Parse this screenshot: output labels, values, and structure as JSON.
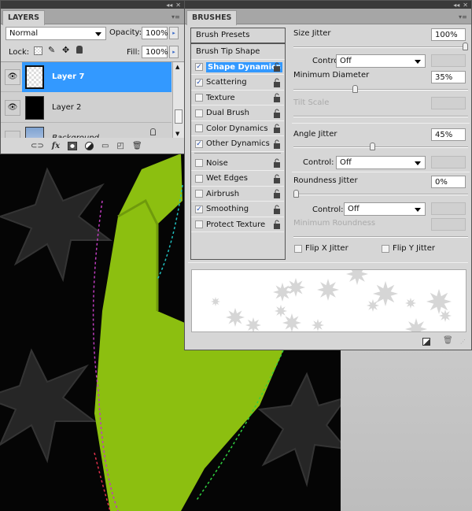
{
  "layers_panel": {
    "tab": "LAYERS",
    "blend_mode": "Normal",
    "opacity_label": "Opacity:",
    "opacity_value": "100%",
    "lock_label": "Lock:",
    "fill_label": "Fill:",
    "fill_value": "100%",
    "layers": [
      {
        "name": "Layer 7",
        "visible": true,
        "selected": true
      },
      {
        "name": "Layer 2",
        "visible": true,
        "selected": false
      },
      {
        "name": "Background",
        "visible": false,
        "selected": false,
        "locked": true
      }
    ],
    "footer_icons": [
      "link-icon",
      "fx-icon",
      "mask-icon",
      "adjustment-icon",
      "folder-icon",
      "new-layer-icon",
      "trash-icon"
    ]
  },
  "brushes_panel": {
    "tab": "BRUSHES",
    "presets_button": "Brush Presets",
    "tip_shape": "Brush Tip Shape",
    "options": [
      {
        "label": "Shape Dynamics",
        "checked": true,
        "selected": true
      },
      {
        "label": "Scattering",
        "checked": true
      },
      {
        "label": "Texture",
        "checked": false
      },
      {
        "label": "Dual Brush",
        "checked": false
      },
      {
        "label": "Color Dynamics",
        "checked": false
      },
      {
        "label": "Other Dynamics",
        "checked": true
      },
      {
        "label": "Noise",
        "checked": false
      },
      {
        "label": "Wet Edges",
        "checked": false
      },
      {
        "label": "Airbrush",
        "checked": false
      },
      {
        "label": "Smoothing",
        "checked": true
      },
      {
        "label": "Protect Texture",
        "checked": false
      }
    ],
    "size_jitter": {
      "label": "Size Jitter",
      "value": "100%",
      "slider": 1.0
    },
    "control_label": "Control:",
    "control1": "Off",
    "min_diameter": {
      "label": "Minimum Diameter",
      "value": "35%",
      "slider": 0.35
    },
    "tilt_scale": {
      "label": "Tilt Scale"
    },
    "angle_jitter": {
      "label": "Angle Jitter",
      "value": "45%",
      "slider": 0.45
    },
    "control2": "Off",
    "roundness_jitter": {
      "label": "Roundness Jitter",
      "value": "0%",
      "slider": 0.0
    },
    "control3": "Off",
    "min_roundness": {
      "label": "Minimum Roundness"
    },
    "flip_x": "Flip X Jitter",
    "flip_y": "Flip Y Jitter"
  },
  "colors": {
    "selection": "#3399ff",
    "panel_bg": "#d6d6d6",
    "hand": "#8cbf10"
  }
}
